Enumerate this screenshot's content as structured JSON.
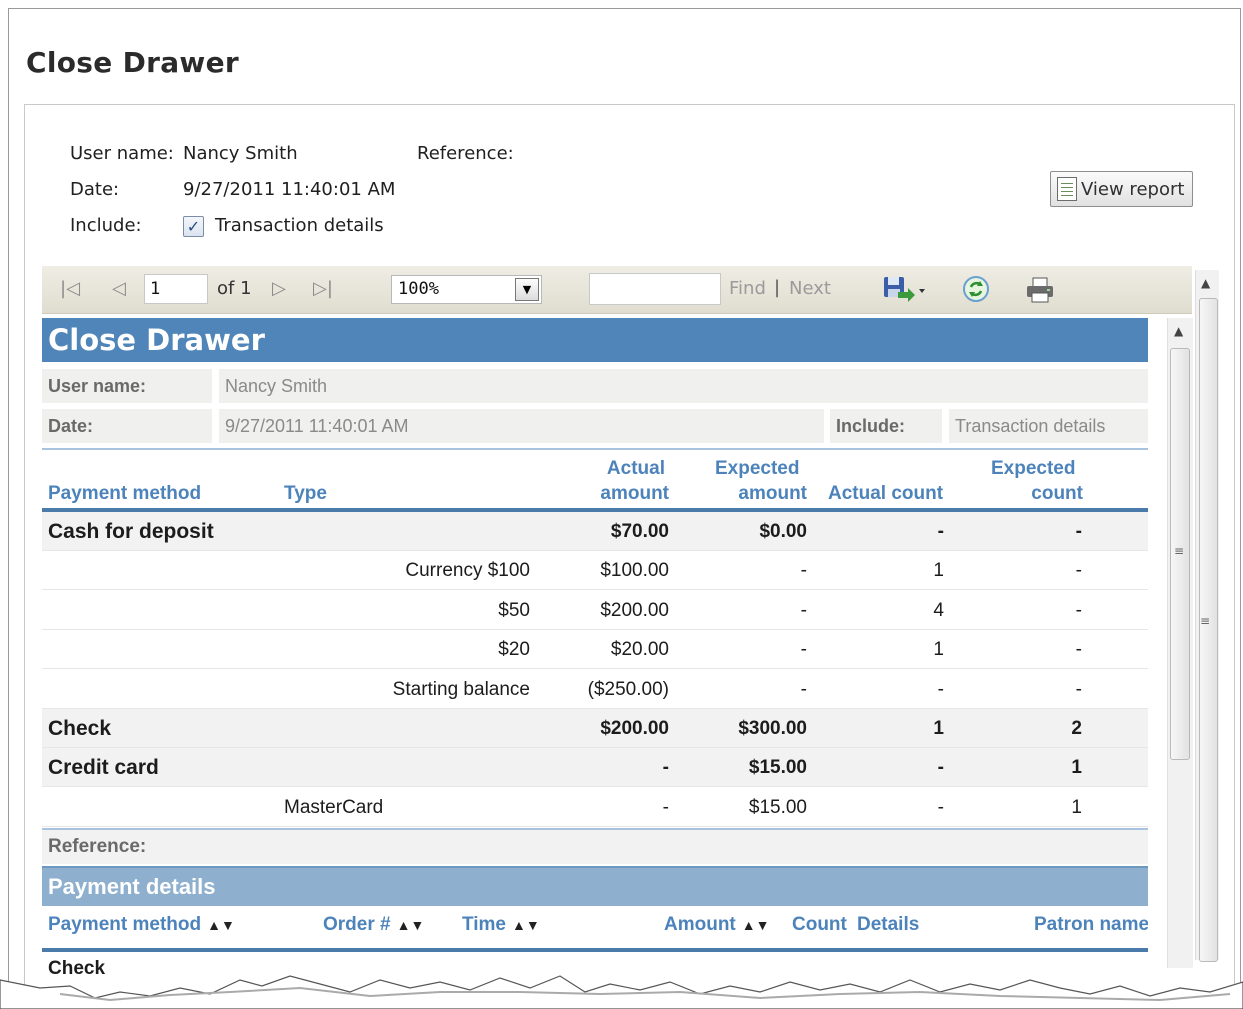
{
  "page": {
    "title": "Close Drawer"
  },
  "params": {
    "user_name_label": "User name:",
    "user_name_value": "Nancy Smith",
    "reference_label": "Reference:",
    "date_label": "Date:",
    "date_value": "9/27/2011 11:40:01 AM",
    "include_label": "Include:",
    "include_option": "Transaction details",
    "include_checked": true,
    "view_report_label": "View report"
  },
  "toolbar": {
    "page_value": "1",
    "page_of": "of 1",
    "zoom_value": "100%",
    "find_value": "",
    "find_label": "Find",
    "separator": "|",
    "next_label": "Next",
    "icons": [
      "first-page-icon",
      "previous-page-icon",
      "next-page-icon",
      "last-page-icon",
      "export-icon",
      "refresh-icon",
      "print-icon"
    ]
  },
  "report": {
    "title": "Close Drawer",
    "user_name_label": "User name:",
    "user_name_value": "Nancy Smith",
    "date_label": "Date:",
    "date_value": "9/27/2011 11:40:01 AM",
    "include_label": "Include:",
    "include_value": "Transaction details",
    "columns": {
      "payment_method": "Payment method",
      "type": "Type",
      "actual_amount_1": "Actual",
      "actual_amount_2": "amount",
      "expected_amount_1": "Expected",
      "expected_amount_2": "amount",
      "actual_count": "Actual count",
      "expected_count_1": "Expected",
      "expected_count_2": "count"
    },
    "rows": [
      {
        "method": "Cash for deposit",
        "type": "",
        "actual_amount": "$70.00",
        "expected_amount": "$0.00",
        "actual_count": "-",
        "expected_count": "-",
        "group": true
      },
      {
        "method": "",
        "type": "Currency $100",
        "actual_amount": "$100.00",
        "expected_amount": "-",
        "actual_count": "1",
        "expected_count": "-",
        "group": false
      },
      {
        "method": "",
        "type": "$50",
        "actual_amount": "$200.00",
        "expected_amount": "-",
        "actual_count": "4",
        "expected_count": "-",
        "group": false
      },
      {
        "method": "",
        "type": "$20",
        "actual_amount": "$20.00",
        "expected_amount": "-",
        "actual_count": "1",
        "expected_count": "-",
        "group": false
      },
      {
        "method": "",
        "type": "Starting balance",
        "actual_amount": "($250.00)",
        "expected_amount": "-",
        "actual_count": "-",
        "expected_count": "-",
        "group": false
      },
      {
        "method": "Check",
        "type": "",
        "actual_amount": "$200.00",
        "expected_amount": "$300.00",
        "actual_count": "1",
        "expected_count": "2",
        "group": true
      },
      {
        "method": "Credit card",
        "type": "",
        "actual_amount": "-",
        "expected_amount": "$15.00",
        "actual_count": "-",
        "expected_count": "1",
        "group": true
      },
      {
        "method": "",
        "type": "MasterCard",
        "actual_amount": "-",
        "expected_amount": "$15.00",
        "actual_count": "-",
        "expected_count": "1",
        "group": false
      }
    ],
    "reference_label": "Reference:",
    "payment_details": {
      "title": "Payment details",
      "columns": {
        "payment_method": "Payment method",
        "order": "Order #",
        "time": "Time",
        "amount": "Amount",
        "count": "Count",
        "details": "Details",
        "patron_name": "Patron name"
      },
      "first_group": "Check"
    }
  }
}
